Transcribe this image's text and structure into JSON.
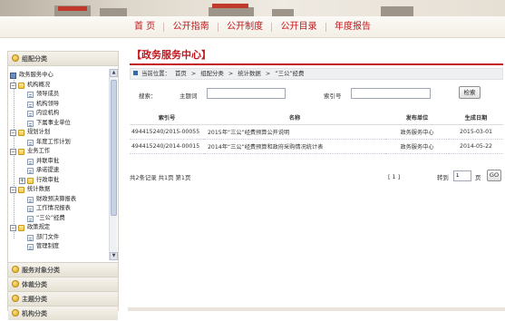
{
  "nav": {
    "items": [
      "首 页",
      "公开指南",
      "公开制度",
      "公开目录",
      "年度报告"
    ]
  },
  "sidebar": {
    "header": "组配分类",
    "tree": {
      "root": "政务服务中心",
      "items": [
        {
          "label": "机构概况",
          "level": 1,
          "type": "folder",
          "toggle": "−"
        },
        {
          "label": "领导成员",
          "level": 2,
          "type": "doc"
        },
        {
          "label": "机构领导",
          "level": 2,
          "type": "doc"
        },
        {
          "label": "内设机构",
          "level": 2,
          "type": "doc"
        },
        {
          "label": "下属事业单位",
          "level": 2,
          "type": "doc"
        },
        {
          "label": "规划计划",
          "level": 1,
          "type": "folder",
          "toggle": "−"
        },
        {
          "label": "年度工作计划",
          "level": 2,
          "type": "doc"
        },
        {
          "label": "业务工作",
          "level": 1,
          "type": "folder",
          "toggle": "−"
        },
        {
          "label": "并联审批",
          "level": 2,
          "type": "doc"
        },
        {
          "label": "承诺提速",
          "level": 2,
          "type": "doc"
        },
        {
          "label": "行政审批",
          "level": 2,
          "type": "folder",
          "toggle": "+"
        },
        {
          "label": "统计数据",
          "level": 1,
          "type": "folder",
          "toggle": "−"
        },
        {
          "label": "财政预决算报表",
          "level": 2,
          "type": "doc"
        },
        {
          "label": "工作情况报表",
          "level": 2,
          "type": "doc"
        },
        {
          "label": "“三公”经费",
          "level": 2,
          "type": "doc"
        },
        {
          "label": "政策规定",
          "level": 1,
          "type": "folder",
          "toggle": "−"
        },
        {
          "label": "部门文件",
          "level": 2,
          "type": "doc"
        },
        {
          "label": "管理制度",
          "level": 2,
          "type": "doc"
        }
      ]
    },
    "categories": [
      "服务对象分类",
      "体裁分类",
      "主题分类",
      "机构分类"
    ]
  },
  "main": {
    "title": "【政务服务中心】",
    "breadcrumb": {
      "prefix": "当前位置：",
      "items": [
        "首页",
        ">",
        "组配分类",
        ">",
        "统计数据",
        ">",
        "“三公”经费"
      ]
    },
    "search": {
      "label": "搜索：",
      "keyword_label": "主题词",
      "keyword_value": "",
      "index_label": "索引号",
      "index_value": "",
      "button": "检索"
    },
    "table": {
      "headers": [
        "索引号",
        "名称",
        "发布单位",
        "生成日期"
      ],
      "rows": [
        {
          "index": "494415240/2015-00055",
          "name": "2015年“三公”经费预算公开说明",
          "unit": "政务服务中心",
          "date": "2015-03-01"
        },
        {
          "index": "494415240/2014-00015",
          "name": "2014年“三公”经费预算和政府采购情况统计表",
          "unit": "政务服务中心",
          "date": "2014-05-22"
        }
      ]
    },
    "pager": {
      "info": "共2条记录  共1页  第1页",
      "pages": "[ 1 ]",
      "goto_label": "转到",
      "page_value": "1",
      "unit": "页",
      "go": "GO"
    }
  },
  "colors": {
    "accent": "#c4161c",
    "crumb_square": "#2b6cb0"
  }
}
